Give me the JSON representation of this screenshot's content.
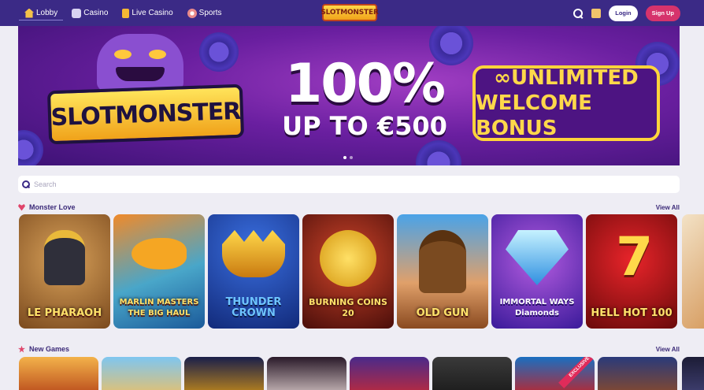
{
  "header": {
    "nav": [
      {
        "label": "Lobby",
        "icon": "home-icon"
      },
      {
        "label": "Casino",
        "icon": "slot-machine-icon"
      },
      {
        "label": "Live Casino",
        "icon": "card-icon"
      },
      {
        "label": "Sports",
        "icon": "ball-icon"
      }
    ],
    "logo_text": "SLOTMONSTER",
    "login_label": "Login",
    "signup_label": "Sign Up"
  },
  "banner": {
    "logo_text": "SLOTMONSTER",
    "headline": "100%",
    "subline": "UP TO €500",
    "box_line1": "∞UNLIMITED",
    "box_line2": "WELCOME BONUS",
    "slide_count": 2,
    "active_slide": 1
  },
  "search": {
    "placeholder": "Search"
  },
  "sections": [
    {
      "title": "Monster Love",
      "view_all": "View All",
      "icon": "heart-icon",
      "games": [
        {
          "name": "LE PHARAOH"
        },
        {
          "name": "MARLIN MASTERS THE BIG HAUL"
        },
        {
          "name": "THUNDER CROWN"
        },
        {
          "name": "BURNING COINS 20"
        },
        {
          "name": "OLD GUN"
        },
        {
          "name": "IMMORTAL WAYS Diamonds"
        },
        {
          "name": "HELL HOT 100"
        }
      ]
    },
    {
      "title": "New Games",
      "view_all": "View All",
      "icon": "star-icon",
      "badge": "EXCLUSIVE",
      "tile_count": 8
    }
  ],
  "colors": {
    "header_bg": "#3b2a86",
    "page_bg": "#eeedf4",
    "signup_bg": "#d6336c",
    "accent_pink": "#e0456b"
  }
}
